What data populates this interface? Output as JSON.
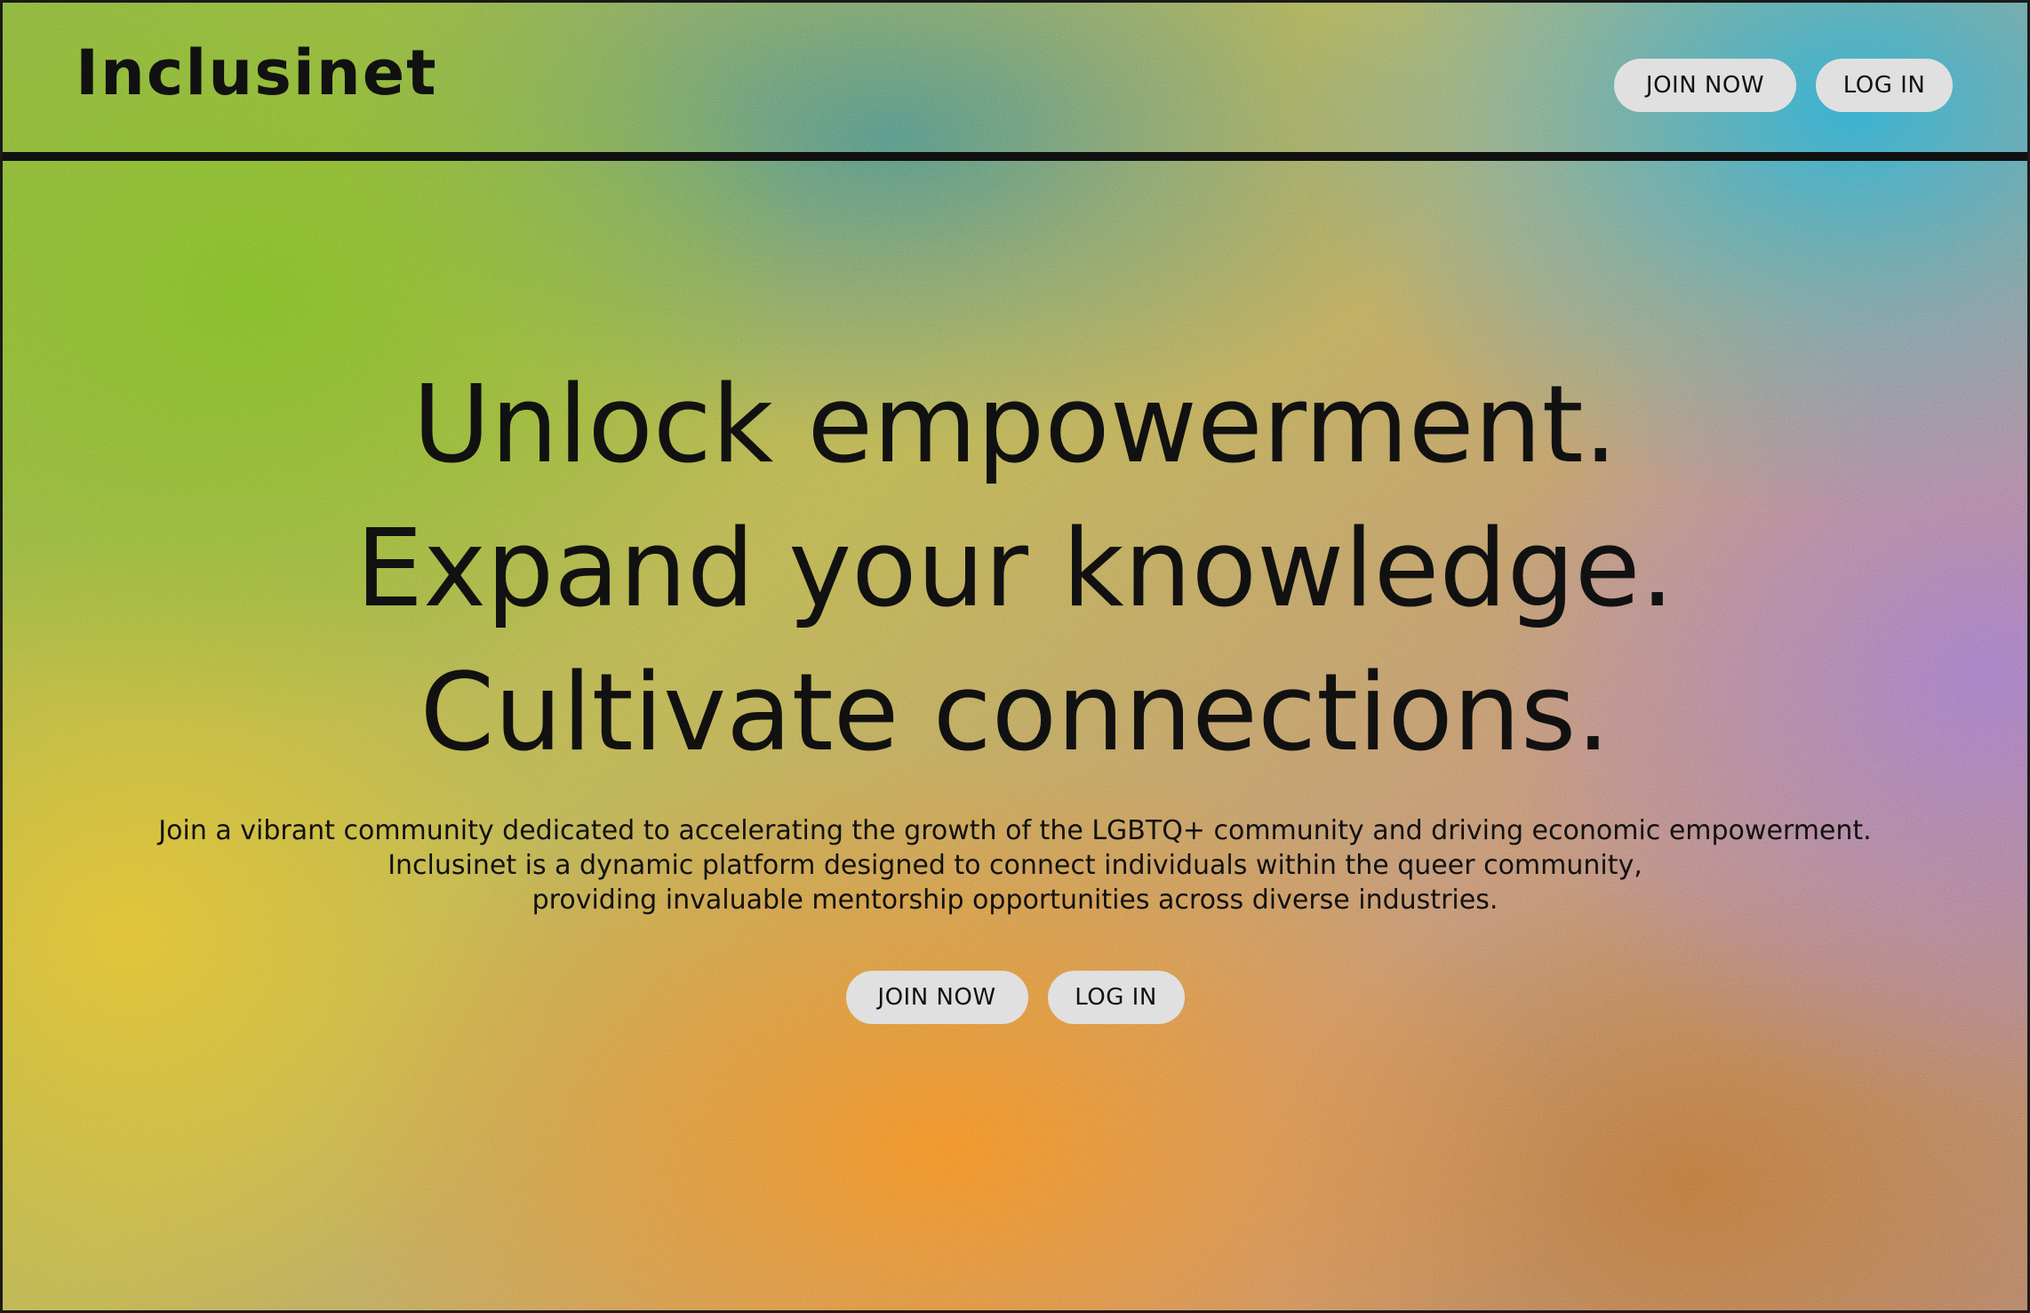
{
  "header": {
    "logo": "Inclusinet",
    "join_label": "JOIN NOW",
    "login_label": "LOG IN"
  },
  "hero": {
    "headline_lines": [
      "Unlock empowerment.",
      "Expand your knowledge.",
      "Cultivate connections."
    ],
    "description_lines": [
      "Join a vibrant community dedicated to accelerating the growth of the LGBTQ+ community and driving economic empowerment.",
      "Inclusinet is a dynamic platform designed to connect individuals within the queer community,",
      "providing invaluable mentorship opportunities across diverse industries."
    ],
    "join_label": "JOIN NOW",
    "login_label": "LOG IN"
  },
  "colors": {
    "button_background": "#e0e0e0",
    "text": "#111111",
    "divider": "#111111"
  }
}
